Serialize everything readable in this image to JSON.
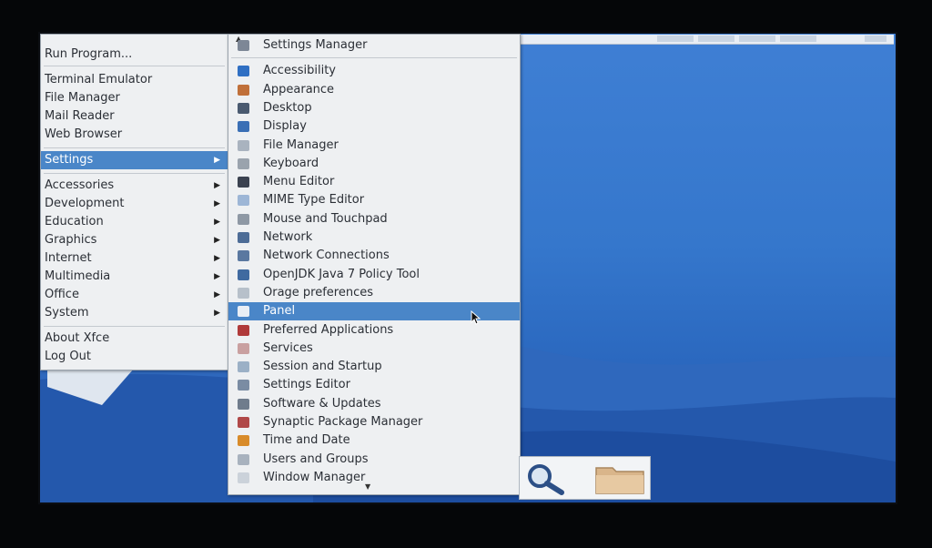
{
  "app_menu": {
    "items": [
      {
        "label": "Run Program...",
        "submenu": false
      },
      {
        "separator": true
      },
      {
        "label": "Terminal Emulator",
        "submenu": false
      },
      {
        "label": "File Manager",
        "submenu": false
      },
      {
        "label": "Mail Reader",
        "submenu": false
      },
      {
        "label": "Web Browser",
        "submenu": false
      },
      {
        "separator": true
      },
      {
        "label": "Settings",
        "submenu": true,
        "selected": true
      },
      {
        "separator": true
      },
      {
        "label": "Accessories",
        "submenu": true
      },
      {
        "label": "Development",
        "submenu": true
      },
      {
        "label": "Education",
        "submenu": true
      },
      {
        "label": "Graphics",
        "submenu": true
      },
      {
        "label": "Internet",
        "submenu": true
      },
      {
        "label": "Multimedia",
        "submenu": true
      },
      {
        "label": "Office",
        "submenu": true
      },
      {
        "label": "System",
        "submenu": true
      },
      {
        "separator": true
      },
      {
        "label": "About Xfce",
        "submenu": false
      },
      {
        "label": "Log Out",
        "submenu": false
      }
    ]
  },
  "settings_menu": {
    "items": [
      {
        "label": "Settings Manager",
        "icon": "settings-manager-icon",
        "color": "#7d8796"
      },
      {
        "separator": true
      },
      {
        "label": "Accessibility",
        "icon": "accessibility-icon",
        "color": "#2f6fc3"
      },
      {
        "label": "Appearance",
        "icon": "appearance-icon",
        "color": "#c0703a"
      },
      {
        "label": "Desktop",
        "icon": "desktop-icon",
        "color": "#4a5a70"
      },
      {
        "label": "Display",
        "icon": "display-icon",
        "color": "#3a6fb5"
      },
      {
        "label": "File Manager",
        "icon": "file-manager-icon",
        "color": "#a9b3bf"
      },
      {
        "label": "Keyboard",
        "icon": "keyboard-icon",
        "color": "#9aa3ad"
      },
      {
        "label": "Menu Editor",
        "icon": "menu-editor-icon",
        "color": "#3b4250"
      },
      {
        "label": "MIME Type Editor",
        "icon": "mime-type-editor-icon",
        "color": "#9db6d6"
      },
      {
        "label": "Mouse and Touchpad",
        "icon": "mouse-icon",
        "color": "#8e98a4"
      },
      {
        "label": "Network",
        "icon": "network-icon",
        "color": "#4d6c96"
      },
      {
        "label": "Network Connections",
        "icon": "network-connections-icon",
        "color": "#5a78a0"
      },
      {
        "label": "OpenJDK Java 7 Policy Tool",
        "icon": "java-icon",
        "color": "#3f6aa0"
      },
      {
        "label": "Orage preferences",
        "icon": "orage-icon",
        "color": "#b7c0ca"
      },
      {
        "label": "Panel",
        "icon": "panel-icon",
        "color": "#e9eef5",
        "selected": true
      },
      {
        "label": "Preferred Applications",
        "icon": "preferred-applications-icon",
        "color": "#b03a3a"
      },
      {
        "label": "Services",
        "icon": "services-icon",
        "color": "#c9a0a0"
      },
      {
        "label": "Session and Startup",
        "icon": "session-icon",
        "color": "#9bb0c6"
      },
      {
        "label": "Settings Editor",
        "icon": "settings-editor-icon",
        "color": "#7a8ca3"
      },
      {
        "label": "Software & Updates",
        "icon": "software-updates-icon",
        "color": "#6f7c8c"
      },
      {
        "label": "Synaptic Package Manager",
        "icon": "synaptic-icon",
        "color": "#b04848"
      },
      {
        "label": "Time and Date",
        "icon": "time-date-icon",
        "color": "#d88b2a"
      },
      {
        "label": "Users and Groups",
        "icon": "users-groups-icon",
        "color": "#a8b2be"
      },
      {
        "label": "Window Manager",
        "icon": "window-manager-icon",
        "color": "#cbd2da"
      }
    ]
  },
  "dock": {
    "search_icon": "search-icon",
    "folder_icon": "folder-icon"
  },
  "colors": {
    "selection": "#4a86c8",
    "menu_bg": "#eef0f2",
    "desktop": "#3577cc"
  }
}
